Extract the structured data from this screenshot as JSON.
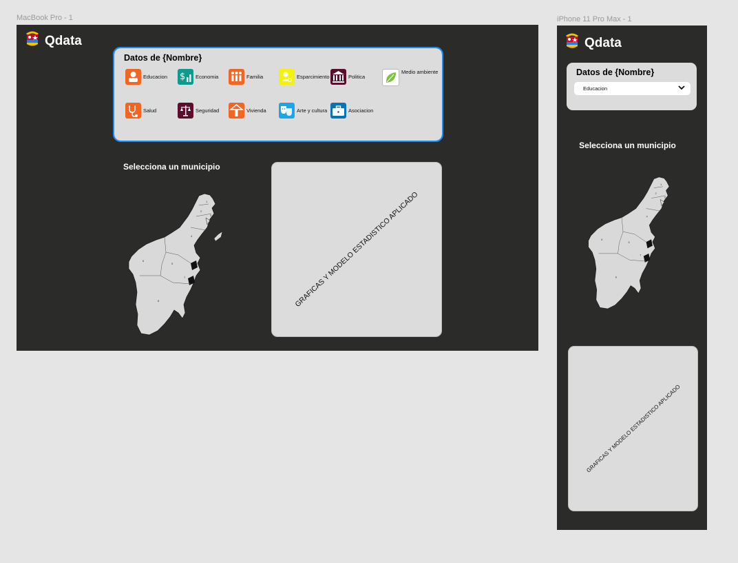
{
  "desktop": {
    "frame_label": "MacBook Pro - 1",
    "brand": "Qdata",
    "card_title": "Datos de {Nombre}",
    "categories": [
      {
        "label": "Educacion",
        "color": "#f26522",
        "icon": "graduate-icon"
      },
      {
        "label": "Economia",
        "color": "#0e9a8e",
        "icon": "money-chart-icon"
      },
      {
        "label": "Familia",
        "color": "#f26522",
        "icon": "family-icon"
      },
      {
        "label": "Esparcimiento",
        "color": "#f2f20a",
        "icon": "leisure-icon"
      },
      {
        "label": "Politica",
        "color": "#5a0e2e",
        "icon": "government-building-icon"
      },
      {
        "label": "Medio ambiente",
        "color": "#ffffff",
        "icon": "leaf-icon"
      },
      {
        "label": "Salud",
        "color": "#f26522",
        "icon": "stethoscope-icon"
      },
      {
        "label": "Seguridad",
        "color": "#5a0e2e",
        "icon": "justice-scale-icon"
      },
      {
        "label": "Vivienda",
        "color": "#f26522",
        "icon": "house-icon"
      },
      {
        "label": "Arte y cultura",
        "color": "#1aa6e8",
        "icon": "theater-masks-icon"
      },
      {
        "label": "Asociacion",
        "color": "#0a73b8",
        "icon": "briefcase-icon"
      }
    ],
    "map_title": "Selecciona un municipio",
    "chart_placeholder": "GRAFICAS Y MODELO ESTADISTICO APLICADO"
  },
  "mobile": {
    "frame_label": "iPhone 11 Pro Max - 1",
    "brand": "Qdata",
    "card_title": "Datos de {Nombre}",
    "select_value": "Educacion",
    "map_title": "Selecciona un municipio",
    "chart_placeholder": "GRAFICAS Y MODELO ESTADISTICO APLICADO"
  },
  "map": {
    "municipality_labels": [
      "1",
      "2",
      "3",
      "4",
      "5",
      "6",
      "7",
      "8"
    ]
  },
  "colors": {
    "artboard": "#2b2b2a",
    "card": "#dcdcdc",
    "selection": "#1a8cff",
    "map_fill": "#d9d9d9"
  }
}
